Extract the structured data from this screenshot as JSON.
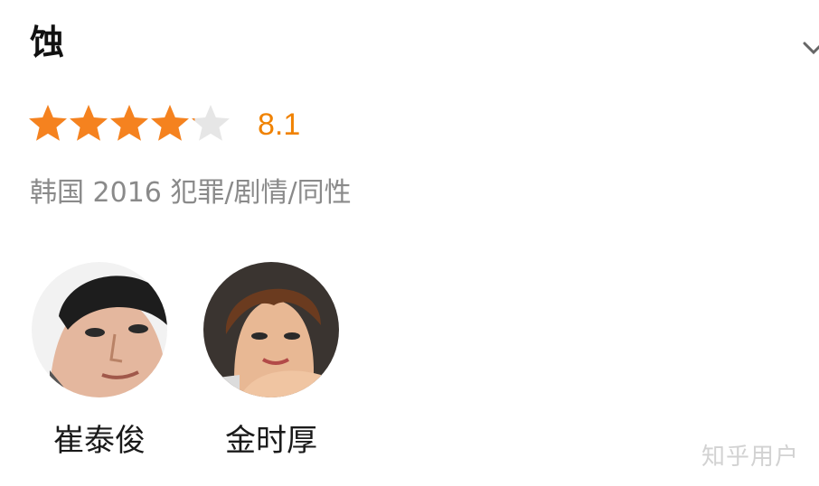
{
  "title": "蚀",
  "rating": {
    "score": "8.1",
    "stars_filled": 4.1,
    "stars_total": 5,
    "filled_color": "#f5821f",
    "empty_color": "#e6e6e6"
  },
  "meta": "韩国 2016 犯罪/剧情/同性",
  "cast": [
    {
      "name": "崔泰俊"
    },
    {
      "name": "金时厚"
    }
  ],
  "watermark": "知乎用户",
  "icons": {
    "expand": "chevron-down-icon",
    "star": "star-icon"
  }
}
